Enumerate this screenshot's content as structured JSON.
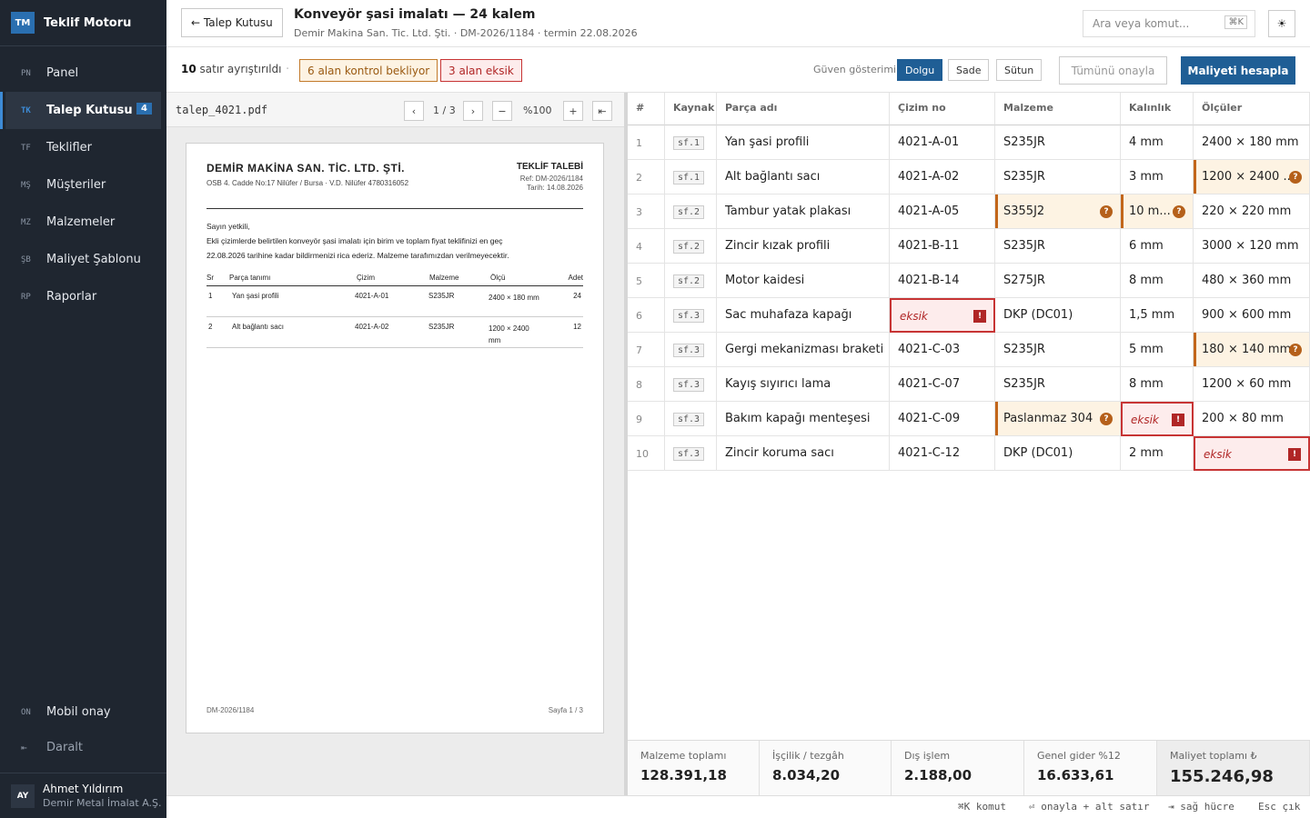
{
  "app": {
    "logo": "TM",
    "name": "Teklif Motoru"
  },
  "sidebar": {
    "items": [
      {
        "ab": "PN",
        "label": "Panel"
      },
      {
        "ab": "TK",
        "label": "Talep Kutusu",
        "badge": "4"
      },
      {
        "ab": "TF",
        "label": "Teklifler"
      },
      {
        "ab": "MŞ",
        "label": "Müşteriler"
      },
      {
        "ab": "MZ",
        "label": "Malzemeler"
      },
      {
        "ab": "ŞB",
        "label": "Maliyet Şablonu"
      },
      {
        "ab": "RP",
        "label": "Raporlar"
      }
    ],
    "mobile": {
      "ab": "ON",
      "label": "Mobil onay"
    },
    "collapse": {
      "ab": "⇤",
      "label": "Daralt"
    },
    "user": {
      "initials": "AY",
      "name": "Ahmet Yıldırım",
      "company": "Demir Metal İmalat A.Ş."
    }
  },
  "header": {
    "back": "← Talep Kutusu",
    "title": "Konveyör şasi imalatı — 24 kalem",
    "subtitle": "Demir Makina San. Tic. Ltd. Şti. · DM-2026/1184 · termin 22.08.2026",
    "search_placeholder": "Ara veya komut...",
    "search_kbd": "⌘K",
    "theme_icon": "☀"
  },
  "toolbar": {
    "parsed_count": "10",
    "parsed_text": "satır ayrıştırıldı",
    "sep": "·",
    "warn_chip": "6 alan kontrol bekliyor",
    "err_chip": "3 alan eksik",
    "confidence_label": "Güven gösterimi",
    "modes": [
      "Dolgu",
      "Sade",
      "Sütun"
    ],
    "approve_all": "Tümünü onayla",
    "calc": "Maliyeti hesapla"
  },
  "pdf": {
    "filename": "talep_4021.pdf",
    "prev": "‹",
    "next": "›",
    "page": "1 / 3",
    "zoom_out": "−",
    "zoom": "%100",
    "zoom_in": "+",
    "collapse": "⇤",
    "doc": {
      "company": "DEMİR MAKİNA SAN. TİC. LTD. ŞTİ.",
      "address": "OSB 4. Cadde No:17 Nilüfer / Bursa · V.D. Nilüfer 4780316052",
      "doc_title": "TEKLİF TALEBİ",
      "ref": "Ref: DM-2026/1184",
      "date": "Tarih: 14.08.2026",
      "greeting": "Sayın yetkili,",
      "body1": "Ekli çizimlerde belirtilen konveyör şasi imalatı için birim ve toplam fiyat teklifinizi en geç",
      "body2": "22.08.2026 tarihine kadar bildirmenizi rica ederiz. Malzeme tarafımızdan verilmeyecektir.",
      "headers": [
        "Sr",
        "Parça tanımı",
        "Çizim",
        "Malzeme",
        "Ölçü",
        "Adet"
      ],
      "rows": [
        [
          "1",
          "Yan şasi profili",
          "4021-A-01",
          "S235JR",
          "2400 × 180 mm",
          "24"
        ],
        [
          "2",
          "Alt bağlantı sacı",
          "4021-A-02",
          "S235JR",
          "1200 × 2400 mm",
          "12"
        ]
      ],
      "footer_left": "DM-2026/1184",
      "footer_right": "Sayfa 1 / 3"
    }
  },
  "table": {
    "headers": [
      "#",
      "Kaynak",
      "Parça adı",
      "Çizim no",
      "Malzeme",
      "Kalınlık",
      "Ölçüler"
    ],
    "rows": [
      [
        "1",
        "sf.1",
        "Yan şasi profili",
        "4021-A-01",
        "S235JR",
        "4 mm",
        "2400 × 180 mm"
      ],
      [
        "2",
        "sf.1",
        "Alt bağlantı sacı",
        "4021-A-02",
        "S235JR",
        "3 mm",
        "1200 × 2400 ..."
      ],
      [
        "3",
        "sf.2",
        "Tambur yatak plakası",
        "4021-A-05",
        "S355J2",
        "10 m...",
        "220 × 220 mm"
      ],
      [
        "4",
        "sf.2",
        "Zincir kızak profili",
        "4021-B-11",
        "S235JR",
        "6 mm",
        "3000 × 120 mm"
      ],
      [
        "5",
        "sf.2",
        "Motor kaidesi",
        "4021-B-14",
        "S275JR",
        "8 mm",
        "480 × 360 mm"
      ],
      [
        "6",
        "sf.3",
        "Sac muhafaza kapağı",
        "eksik",
        "DKP (DC01)",
        "1,5 mm",
        "900 × 600 mm"
      ],
      [
        "7",
        "sf.3",
        "Gergi mekanizması braketi",
        "4021-C-03",
        "S235JR",
        "5 mm",
        "180 × 140 mm"
      ],
      [
        "8",
        "sf.3",
        "Kayış sıyırıcı lama",
        "4021-C-07",
        "S235JR",
        "8 mm",
        "1200 × 60 mm"
      ],
      [
        "9",
        "sf.3",
        "Bakım kapağı menteşesi",
        "4021-C-09",
        "Paslanmaz 304",
        "eksik",
        "200 × 80 mm"
      ],
      [
        "10",
        "sf.3",
        "Zincir koruma sacı",
        "4021-C-12",
        "DKP (DC01)",
        "2 mm",
        "eksik"
      ]
    ],
    "flags": {
      "warn": [
        "1-6",
        "2-4",
        "2-5",
        "6-6",
        "8-4"
      ],
      "err": [
        "5-3",
        "8-5",
        "9-6"
      ]
    }
  },
  "summary": [
    {
      "label": "Malzeme toplamı",
      "value": "128.391,18"
    },
    {
      "label": "İşçilik / tezgâh",
      "value": "8.034,20"
    },
    {
      "label": "Dış işlem",
      "value": "2.188,00"
    },
    {
      "label": "Genel gider %12",
      "value": "16.633,61"
    },
    {
      "label": "Maliyet toplamı ₺",
      "value": "155.246,98"
    }
  ],
  "shortcuts": [
    "⌘K komut",
    "⏎ onayla + alt satır",
    "⇥ sağ hücre",
    "Esc çık"
  ],
  "colors": {
    "accent": "#1f5e95",
    "warn": "#c2661a",
    "error": "#c73434",
    "sidebar": "#1f2630"
  }
}
